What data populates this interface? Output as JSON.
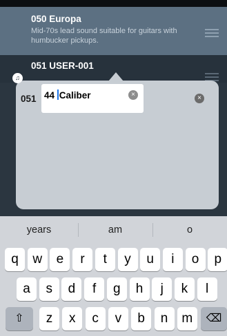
{
  "list": {
    "items": [
      {
        "title": "050 Europa",
        "description": "Mid-70s lead sound suitable for guitars with humbucker pickups."
      },
      {
        "title": "051 USER-001",
        "description": ""
      }
    ]
  },
  "rename_popup": {
    "number": "051",
    "name_value": "44 Caliber",
    "clear_icon": "×",
    "close_icon": "×"
  },
  "keyboard": {
    "suggestions": [
      "years",
      "am",
      "o"
    ],
    "rows": [
      [
        "q",
        "w",
        "e",
        "r",
        "t",
        "y",
        "u",
        "i",
        "o",
        "p"
      ],
      [
        "a",
        "s",
        "d",
        "f",
        "g",
        "h",
        "j",
        "k",
        "l"
      ],
      [
        "z",
        "x",
        "c",
        "v",
        "b",
        "n",
        "m"
      ]
    ],
    "shift_glyph": "⇧",
    "delete_glyph": "⌫"
  },
  "icons": {
    "speaker": "speaker-icon",
    "menu": "hamburger-menu-icon"
  },
  "colors": {
    "selected_row": "#5c7082",
    "popup_background": "#c7cdd3",
    "keyboard_background": "#d1d4d9",
    "caret": "#1a73e8"
  }
}
